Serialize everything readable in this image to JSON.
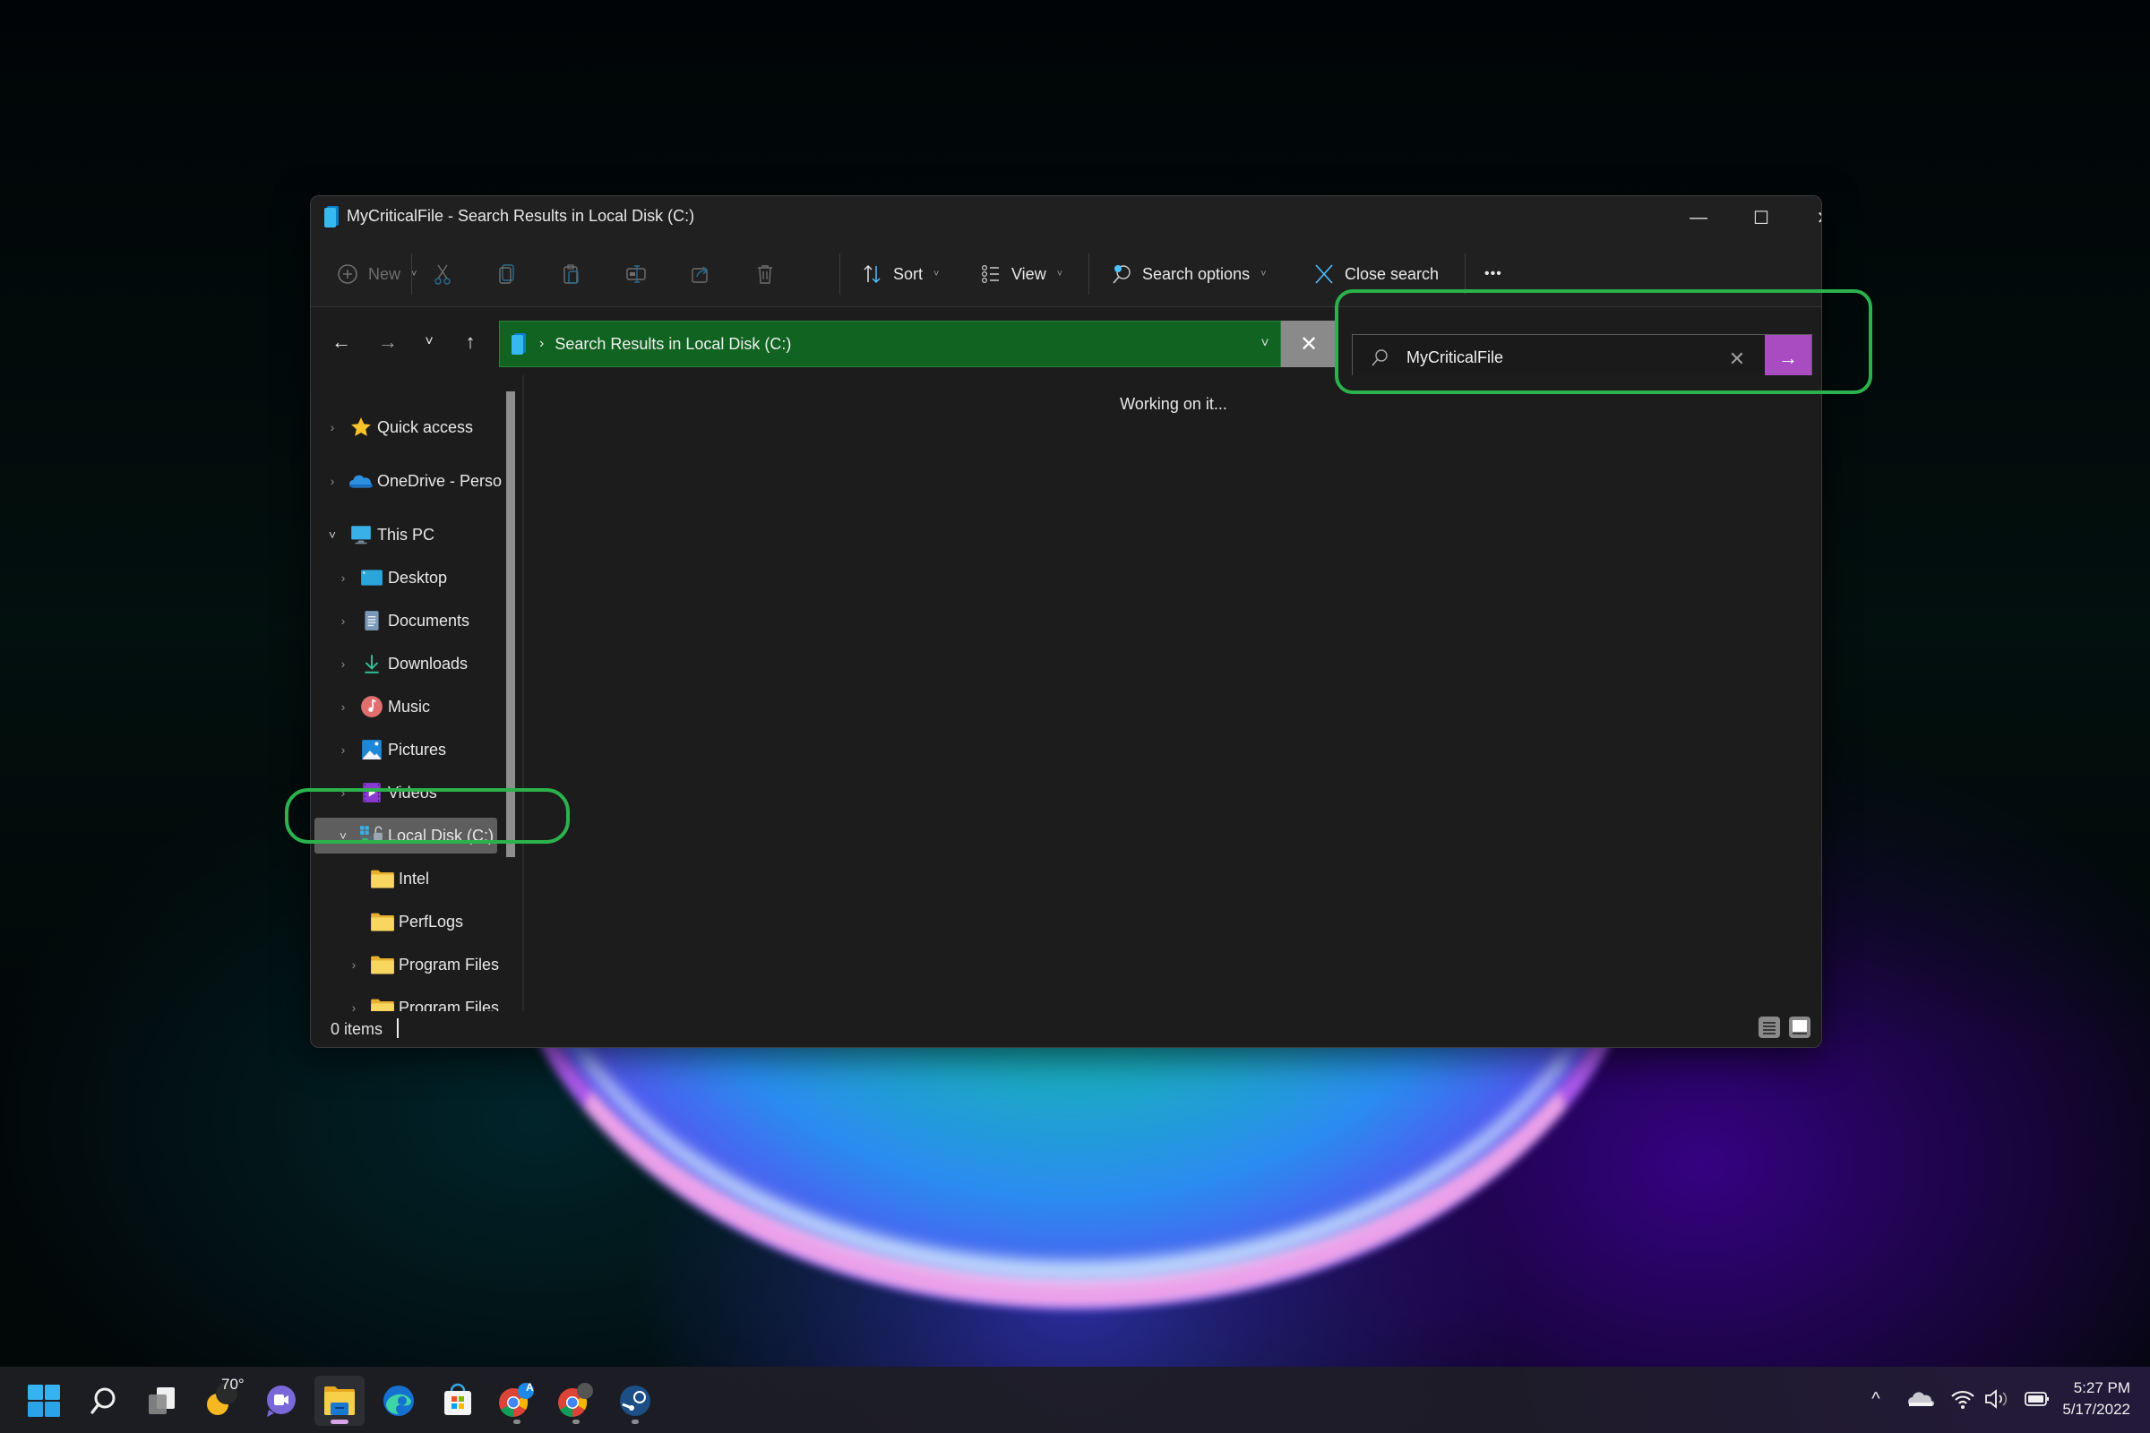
{
  "window": {
    "title": "MyCriticalFile - Search Results in Local Disk (C:)",
    "controls": {
      "minimize": "—",
      "maximize": "☐",
      "close": "✕"
    }
  },
  "toolbar": {
    "new_label": "New",
    "sort_label": "Sort",
    "view_label": "View",
    "search_options_label": "Search options",
    "close_search_label": "Close search",
    "more_label": "•••",
    "caret": "˅",
    "icons": [
      "cut-icon",
      "copy-icon",
      "paste-icon",
      "rename-icon",
      "share-icon",
      "delete-icon"
    ]
  },
  "nav": {
    "back": "←",
    "forward": "→",
    "recent": "˅",
    "up": "↑"
  },
  "address": {
    "chevron": "›",
    "path": "Search Results in Local Disk (C:)",
    "dropdown": "˅",
    "clear": "✕",
    "highlight_color": "#106320"
  },
  "search": {
    "value": "MyCriticalFile",
    "clear": "✕",
    "go": "→",
    "go_color": "#a94cc2"
  },
  "sidebar": {
    "items": [
      {
        "label": "Quick access",
        "chevron": "›",
        "icon": "star-icon"
      },
      {
        "label": "OneDrive - Perso",
        "chevron": "›",
        "icon": "onedrive-icon"
      },
      {
        "label": "This PC",
        "chevron": "˅",
        "icon": "monitor-icon"
      },
      {
        "label": "Desktop",
        "chevron": "›",
        "icon": "desktop-icon"
      },
      {
        "label": "Documents",
        "chevron": "›",
        "icon": "documents-icon"
      },
      {
        "label": "Downloads",
        "chevron": "›",
        "icon": "download-icon"
      },
      {
        "label": "Music",
        "chevron": "›",
        "icon": "music-icon"
      },
      {
        "label": "Pictures",
        "chevron": "›",
        "icon": "pictures-icon"
      },
      {
        "label": "Videos",
        "chevron": "›",
        "icon": "videos-icon"
      },
      {
        "label": "Local Disk (C:)",
        "chevron": "˅",
        "icon": "drive-icon",
        "selected": true
      },
      {
        "label": "Intel",
        "chevron": "",
        "icon": "folder-icon"
      },
      {
        "label": "PerfLogs",
        "chevron": "",
        "icon": "folder-icon"
      },
      {
        "label": "Program Files",
        "chevron": "›",
        "icon": "folder-icon"
      },
      {
        "label": "Program Files",
        "chevron": "›",
        "icon": "folder-icon"
      }
    ]
  },
  "content": {
    "status_message": "Working on it..."
  },
  "statusbar": {
    "item_count": "0 items"
  },
  "annotations": {
    "color": "#2bb24c",
    "targets": [
      "search-box",
      "sidebar-item-local-disk"
    ]
  },
  "taskbar": {
    "apps": [
      "start",
      "search",
      "task-view",
      "weather",
      "teams-chat",
      "file-explorer",
      "edge",
      "microsoft-store",
      "chrome-profile-a",
      "chrome-profile-b",
      "steam"
    ],
    "weather_temp": "70°",
    "chrome_badge": "A",
    "tray": {
      "overflow": "^"
    },
    "time": "5:27 PM",
    "date": "5/17/2022"
  }
}
